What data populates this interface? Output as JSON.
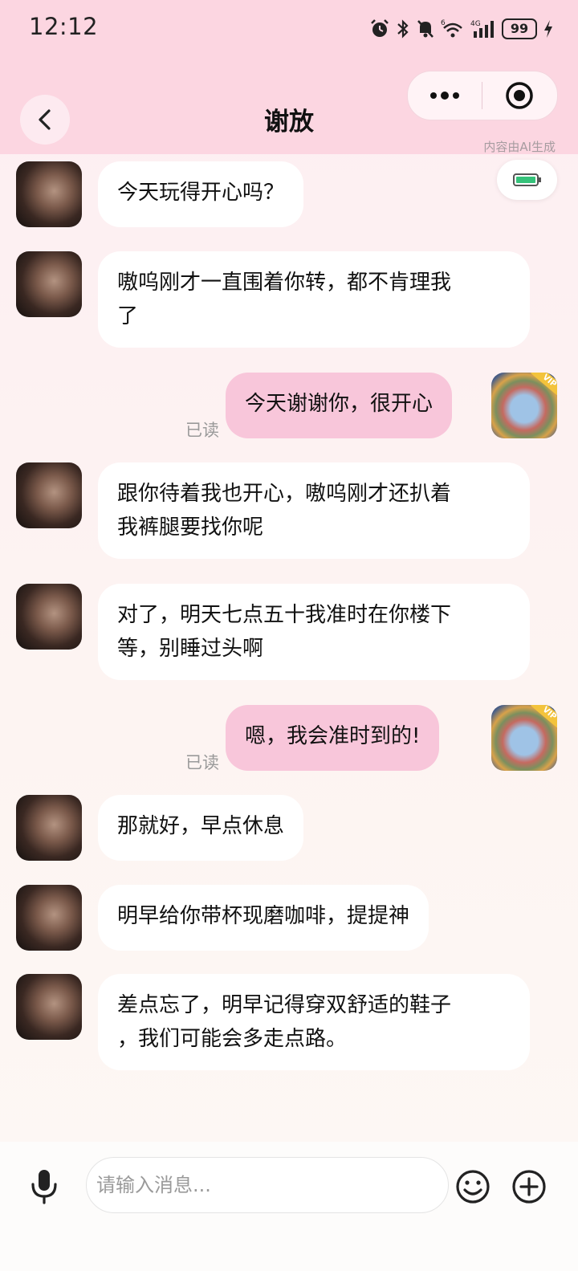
{
  "status_bar": {
    "time": "12:12",
    "battery": "99",
    "network": "4G"
  },
  "header": {
    "title": "谢放",
    "ai_note": "内容由AI生成"
  },
  "messages": [
    {
      "from": "bot",
      "text": "今天玩得开心吗？"
    },
    {
      "from": "bot",
      "text": "嗷呜刚才一直围着你转，都不肯理我\n了"
    },
    {
      "from": "user",
      "text": "今天谢谢你，很开心",
      "status": "已读"
    },
    {
      "from": "bot",
      "text": "跟你待着我也开心，嗷呜刚才还扒着\n我裤腿要找你呢"
    },
    {
      "from": "bot",
      "text": "对了，明天七点五十我准时在你楼下\n等，别睡过头啊"
    },
    {
      "from": "user",
      "text": "嗯，我会准时到的!",
      "status": "已读"
    },
    {
      "from": "bot",
      "text": "那就好，早点休息"
    },
    {
      "from": "bot",
      "text": "明早给你带杯现磨咖啡，提提神"
    },
    {
      "from": "bot",
      "text": "差点忘了，明早记得穿双舒适的鞋子\n，我们可能会多走点路。"
    }
  ],
  "user_avatar_badge": "VIP",
  "input": {
    "placeholder": "请输入消息..."
  },
  "icons": {
    "back": "chevron-left-icon",
    "more": "more-dots-icon",
    "close": "target-close-icon",
    "battery_mode": "battery-icon",
    "mic": "microphone-icon",
    "emoji": "emoji-icon",
    "plus": "plus-circle-icon"
  },
  "colors": {
    "header_bg": "#fcd6e1",
    "user_bubble": "#f8c6da",
    "bot_bubble": "#ffffff"
  }
}
